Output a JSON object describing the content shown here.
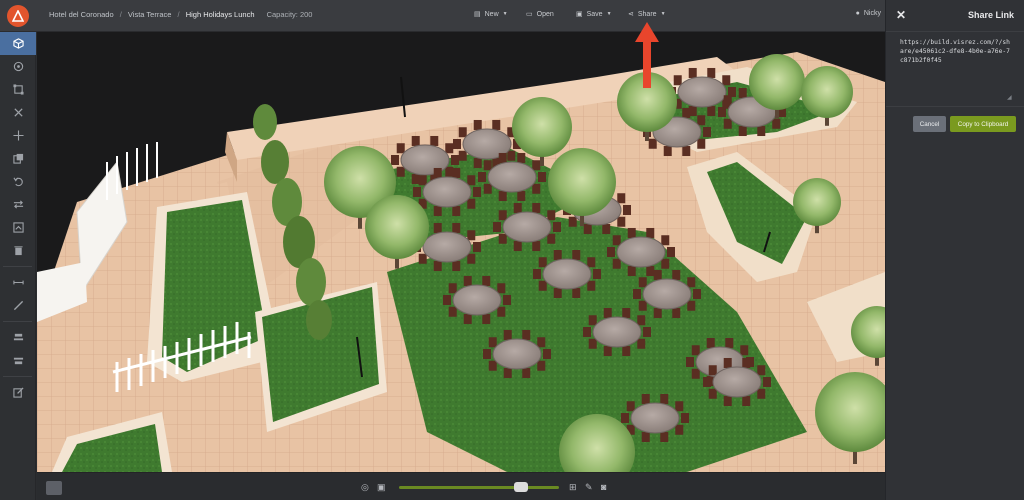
{
  "breadcrumb": {
    "items": [
      "Hotel del Coronado",
      "Vista Terrace",
      "High Holidays Lunch"
    ],
    "separator": "/",
    "capacity": "Capacity: 200"
  },
  "toolbar": {
    "new_label": "New",
    "open_label": "Open",
    "save_label": "Save",
    "share_label": "Share"
  },
  "user": {
    "name": "Nicky"
  },
  "share_panel": {
    "title": "Share Link",
    "link": "https://build.visrez.com/?/share/e45061c2-dfe8-4b0e-a76e-7c871b2f0f45",
    "cancel_label": "Cancel",
    "copy_label": "Copy to Clipboard"
  },
  "colors": {
    "accent": "#7a9a1f",
    "logo": "#e2552d",
    "arrow": "#e8452c",
    "active_tool": "#4a6fa0"
  },
  "icons": {
    "left_tools": [
      "cube-icon",
      "paint-icon",
      "frame-icon",
      "x-icon",
      "move-icon",
      "copy-icon",
      "undo-icon",
      "swap-icon",
      "layers-icon",
      "trash-icon",
      "measure-icon",
      "ruler-icon",
      "align-top-icon",
      "align-bottom-icon",
      "edit-icon"
    ],
    "bottom": [
      "target-icon",
      "layout-icon",
      "grid-icon",
      "pen-icon",
      "camera-icon"
    ]
  }
}
